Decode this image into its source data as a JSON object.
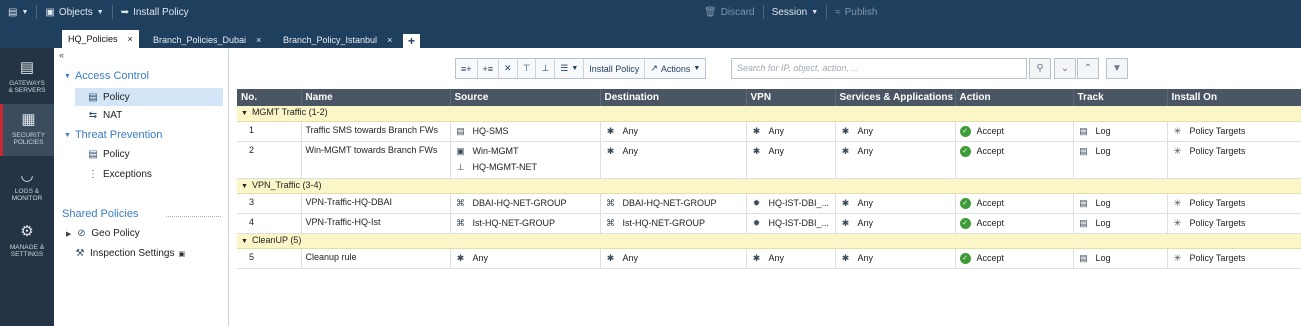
{
  "topbar": {
    "objects": "Objects",
    "install_policy": "Install Policy",
    "discard": "Discard",
    "session": "Session",
    "publish": "Publish"
  },
  "tabs": [
    {
      "label": "HQ_Policies",
      "active": true
    },
    {
      "label": "Branch_Policies_Dubai",
      "active": false
    },
    {
      "label": "Branch_Policy_Istanbul",
      "active": false
    }
  ],
  "leftnav": [
    {
      "line1": "GATEWAYS",
      "line2": "& SERVERS",
      "icon": "servers-icon"
    },
    {
      "line1": "SECURITY",
      "line2": "POLICIES",
      "icon": "grid-icon"
    },
    {
      "line1": "LOGS &",
      "line2": "MONITOR",
      "icon": "gauge-icon"
    },
    {
      "line1": "MANAGE &",
      "line2": "SETTINGS",
      "icon": "gear-icon"
    }
  ],
  "tree": {
    "access_control": "Access Control",
    "ac_policy": "Policy",
    "ac_nat": "NAT",
    "threat_prevention": "Threat Prevention",
    "tp_policy": "Policy",
    "tp_exceptions": "Exceptions",
    "shared_policies": "Shared Policies",
    "geo_policy": "Geo Policy",
    "inspection_settings": "Inspection Settings"
  },
  "toolbar": {
    "install_policy": "Install Policy",
    "actions": "Actions",
    "search_placeholder": "Search for IP, object, action, ..."
  },
  "columns": [
    "No.",
    "Name",
    "Source",
    "Destination",
    "VPN",
    "Services & Applications",
    "Action",
    "Track",
    "Install On"
  ],
  "sections": [
    {
      "title": "MGMT Traffic",
      "range": "(1-2)",
      "rules": [
        {
          "no": "1",
          "name": "Traffic SMS towards Branch FWs",
          "source": [
            "HQ-SMS"
          ],
          "destination": "Any",
          "vpn": "Any",
          "services": "Any",
          "action": "Accept",
          "track": "Log",
          "install_on": "Policy Targets"
        },
        {
          "no": "2",
          "name": "Win-MGMT towards Branch FWs",
          "source": [
            "Win-MGMT",
            "HQ-MGMT-NET"
          ],
          "destination": "Any",
          "vpn": "Any",
          "services": "Any",
          "action": "Accept",
          "track": "Log",
          "install_on": "Policy Targets"
        }
      ]
    },
    {
      "title": "VPN_Traffic",
      "range": "(3-4)",
      "rules": [
        {
          "no": "3",
          "name": "VPN-Traffic-HQ-DBAI",
          "source": [
            "DBAI-HQ-NET-GROUP"
          ],
          "destination": "DBAI-HQ-NET-GROUP",
          "vpn": "HQ-IST-DBI_...",
          "services": "Any",
          "action": "Accept",
          "track": "Log",
          "install_on": "Policy Targets"
        },
        {
          "no": "4",
          "name": "VPN-Traffic-HQ-Ist",
          "source": [
            "Ist-HQ-NET-GROUP"
          ],
          "destination": "Ist-HQ-NET-GROUP",
          "vpn": "HQ-IST-DBI_...",
          "services": "Any",
          "action": "Accept",
          "track": "Log",
          "install_on": "Policy Targets"
        }
      ]
    },
    {
      "title": "CleanUP",
      "range": "(5)",
      "rules": [
        {
          "no": "5",
          "name": "Cleanup rule",
          "source": [
            "Any"
          ],
          "destination": "Any",
          "vpn": "Any",
          "services": "Any",
          "action": "Accept",
          "track": "Log",
          "install_on": "Policy Targets"
        }
      ]
    }
  ]
}
